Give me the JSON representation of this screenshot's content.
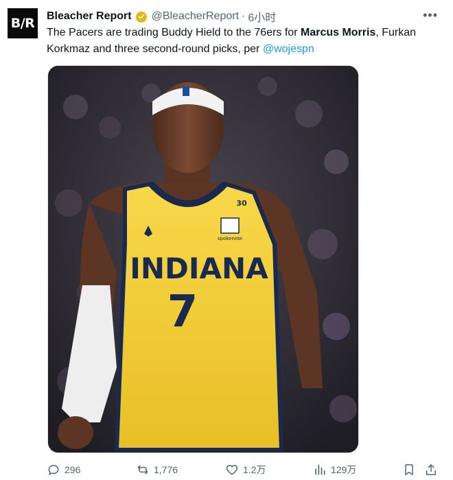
{
  "tweet": {
    "display_name": "Bleacher Report",
    "handle": "@BleacherReport",
    "separator": "·",
    "time": "6小时",
    "avatar_text": "B/R",
    "text": {
      "part1": "The Pacers are trading Buddy Hield to the 76ers for ",
      "bold": "Marcus Morris",
      "part2": ", Furkan Korkmaz and three second-round picks, per ",
      "mention": "@wojespn"
    },
    "image": {
      "jersey_team": "INDIANA",
      "jersey_number": "7",
      "side_number": "30",
      "sponsor": "spokenote"
    }
  },
  "actions": {
    "replies": "296",
    "reposts": "1,776",
    "likes": "1.2万",
    "views": "129万"
  },
  "icons": {
    "more": "more-icon",
    "verified": "verified-badge-icon",
    "reply": "reply-icon",
    "repost": "repost-icon",
    "like": "like-icon",
    "views": "views-icon",
    "bookmark": "bookmark-icon",
    "share": "share-icon"
  },
  "colors": {
    "text": "#0f1419",
    "muted": "#536471",
    "link": "#1d9bf0",
    "gold_badge": "#e2b719",
    "jersey_yellow": "#f5d13b",
    "jersey_navy": "#1a2a4f"
  }
}
